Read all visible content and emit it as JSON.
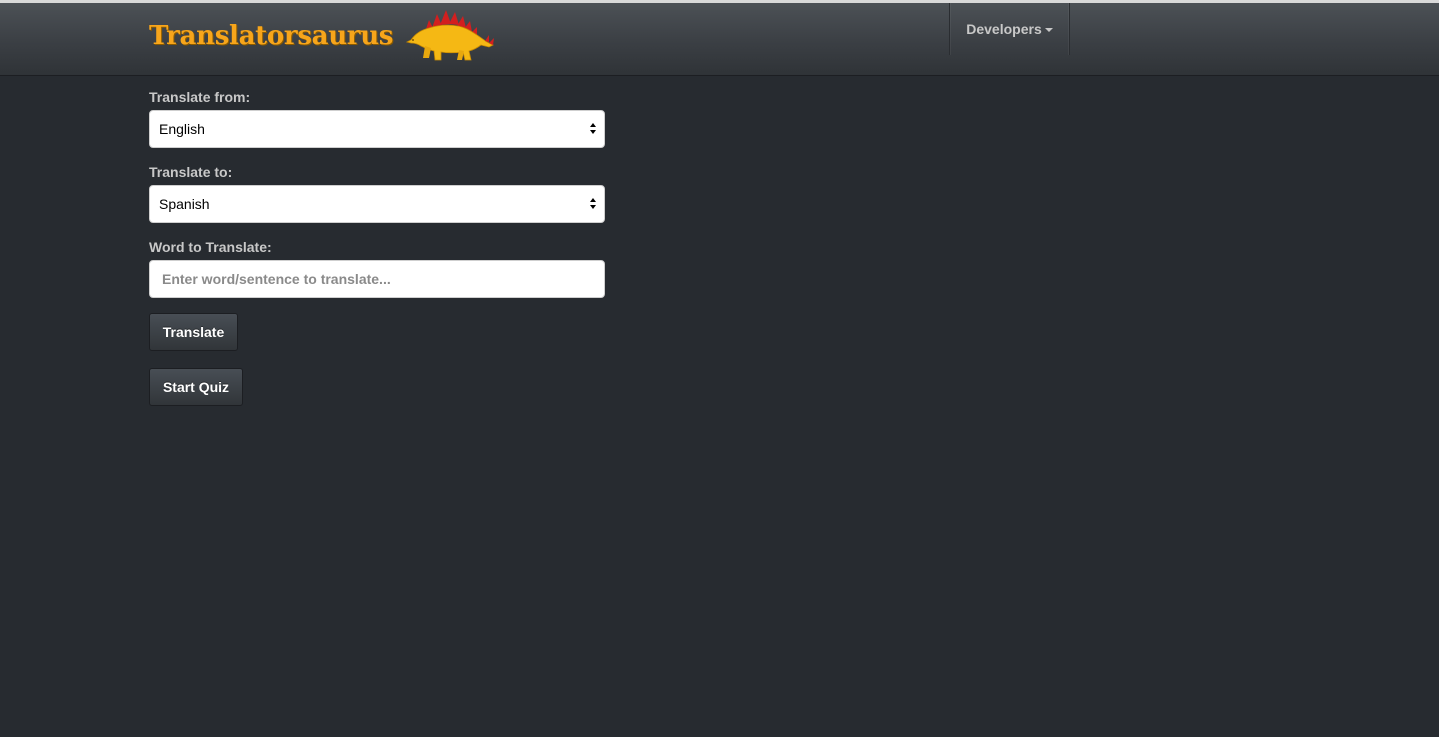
{
  "navbar": {
    "brand_name": "Translatorsaurus",
    "brand_icon": "stegosaurus-icon",
    "developers_label": "Developers",
    "brand_color": "#f7a51b"
  },
  "form": {
    "from_label": "Translate from:",
    "from_value": "English",
    "to_label": "Translate to:",
    "to_value": "Spanish",
    "word_label": "Word to Translate:",
    "word_placeholder": "Enter word/sentence to translate...",
    "word_value": "",
    "translate_button": "Translate",
    "quiz_button": "Start Quiz"
  },
  "colors": {
    "background": "#272b30",
    "navbar": "#3b3f44",
    "accent": "#f7a51b"
  }
}
